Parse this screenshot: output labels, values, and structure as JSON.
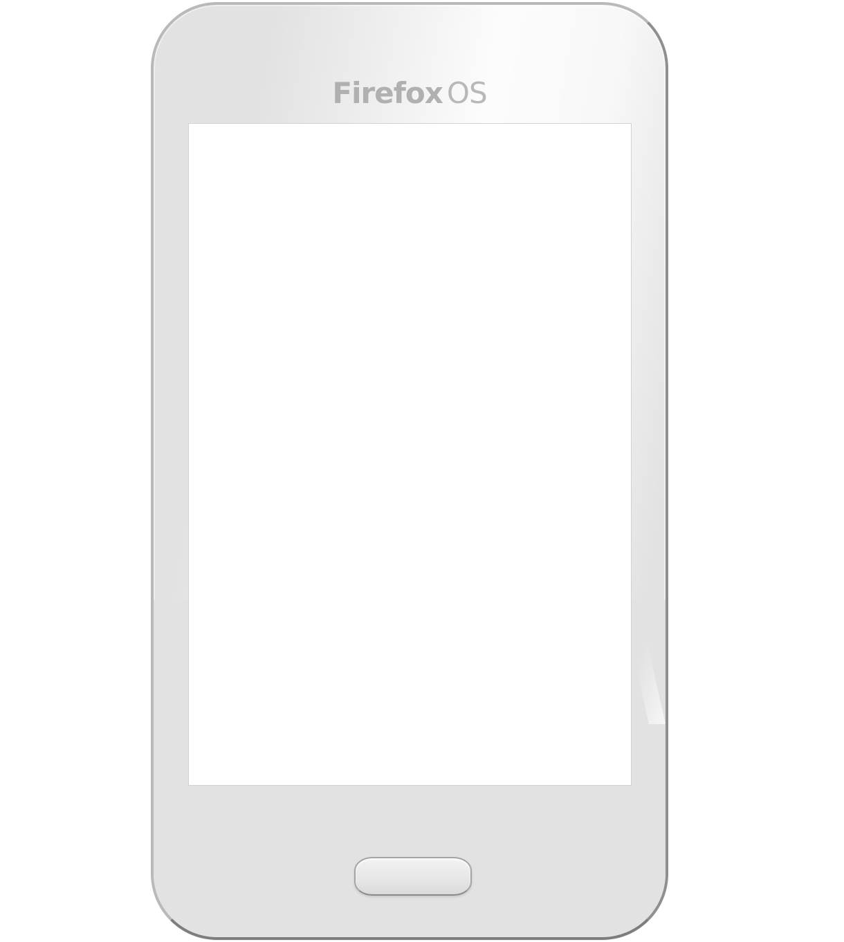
{
  "device": {
    "brand_part1": "Firefox",
    "brand_part2": "OS",
    "colors": {
      "frame": "#e2e2e2",
      "frame_border": "#b9b9b9",
      "screen": "#ffffff",
      "brand_text": "#b0b0b0"
    }
  },
  "screen": {
    "content": ""
  }
}
